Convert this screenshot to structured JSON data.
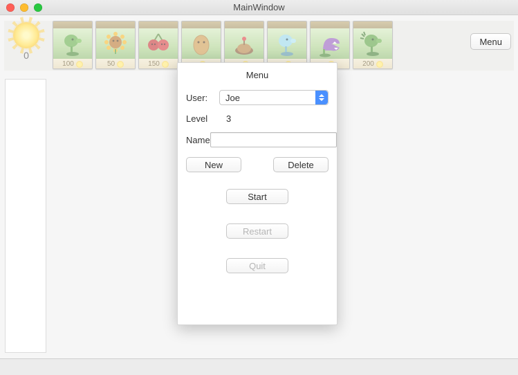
{
  "window": {
    "title": "MainWindow"
  },
  "sun": {
    "count": "0"
  },
  "cards": [
    {
      "name": "peashooter",
      "cost": "100"
    },
    {
      "name": "sunflower",
      "cost": "50"
    },
    {
      "name": "cherry-bomb",
      "cost": "150"
    },
    {
      "name": "wall-nut",
      "cost": ""
    },
    {
      "name": "potato-mine",
      "cost": ""
    },
    {
      "name": "snow-pea",
      "cost": ""
    },
    {
      "name": "chomper",
      "cost": ""
    },
    {
      "name": "repeater",
      "cost": "200"
    }
  ],
  "menu_button": {
    "label": "Menu"
  },
  "dialog": {
    "title": "Menu",
    "user_label": "User:",
    "user_value": "Joe",
    "level_label": "Level",
    "level_value": "3",
    "name_label": "Name",
    "name_value": "",
    "new_label": "New",
    "delete_label": "Delete",
    "start_label": "Start",
    "restart_label": "Restart",
    "quit_label": "Quit"
  }
}
